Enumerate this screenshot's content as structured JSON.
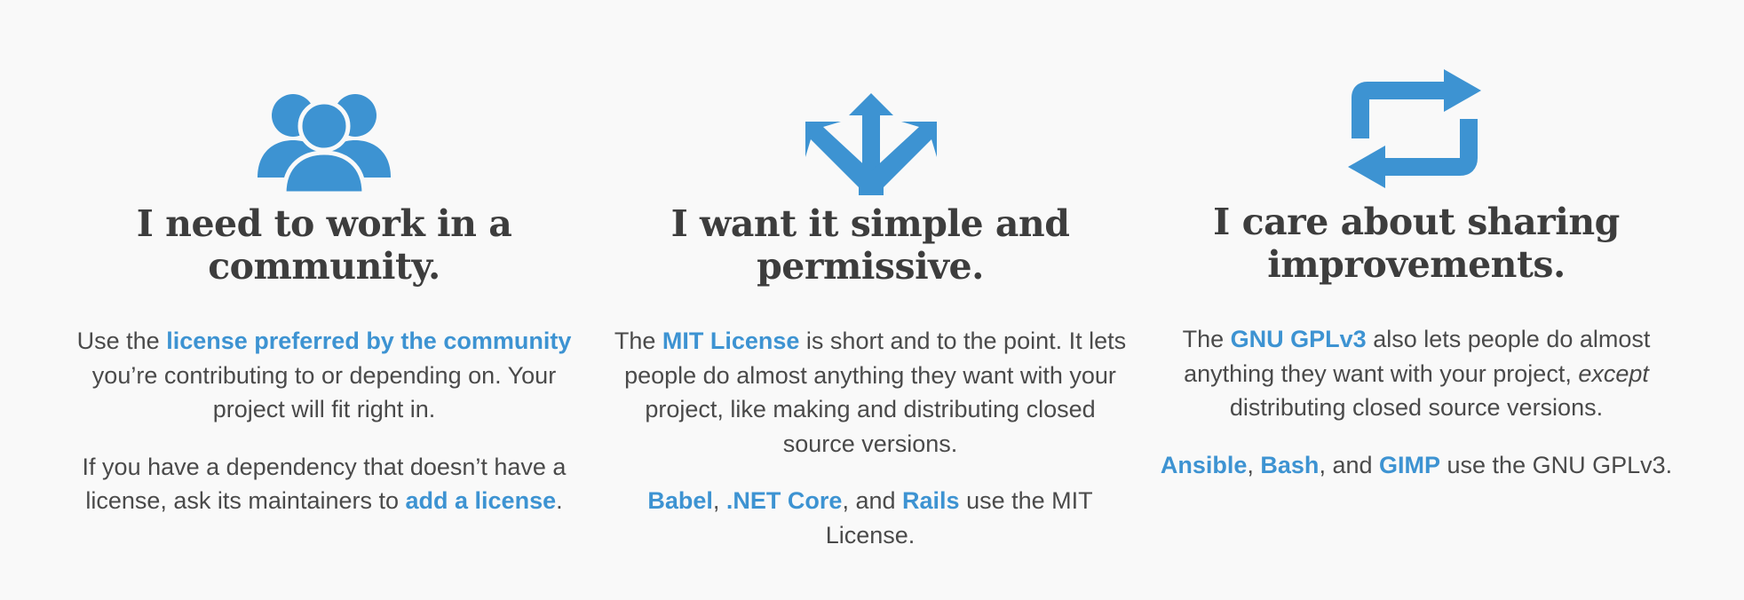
{
  "colors": {
    "background": "#f9f9f9",
    "heading": "#3d3d3d",
    "text": "#4a4a4a",
    "accent": "#3d93d2"
  },
  "columns": [
    {
      "icon": "community-icon",
      "heading_line1": "I need to work in a",
      "heading_line2": "community.",
      "p1": {
        "pre": "Use the ",
        "link": "license preferred by the community",
        "post": " you’re contributing to or depending on. Your project will fit right in."
      },
      "p2": {
        "pre": "If you have a dependency that doesn’t have a license, ask its maintainers to ",
        "link": "add a license",
        "post": "."
      }
    },
    {
      "icon": "simple-arrows-icon",
      "heading_line1": "I want it simple and",
      "heading_line2": "permissive.",
      "p1": {
        "pre": "The ",
        "link": "MIT License",
        "post": " is short and to the point. It lets people do almost anything they want with your project, like making and distributing closed source versions."
      },
      "p2": {
        "link1": "Babel",
        "sep1": ", ",
        "link2": ".NET Core",
        "sep2": ", and ",
        "link3": "Rails",
        "post": " use the MIT License."
      }
    },
    {
      "icon": "sharing-loop-icon",
      "heading_line1": "I care about sharing",
      "heading_line2": "improvements.",
      "p1": {
        "pre": "The ",
        "link": "GNU GPLv3",
        "mid": " also lets people do almost anything they want with your project, ",
        "em": "except",
        "post": " distributing closed source versions."
      },
      "p2": {
        "link1": "Ansible",
        "sep1": ", ",
        "link2": "Bash",
        "sep2": ", and ",
        "link3": "GIMP",
        "post": " use the GNU GPLv3."
      }
    }
  ]
}
